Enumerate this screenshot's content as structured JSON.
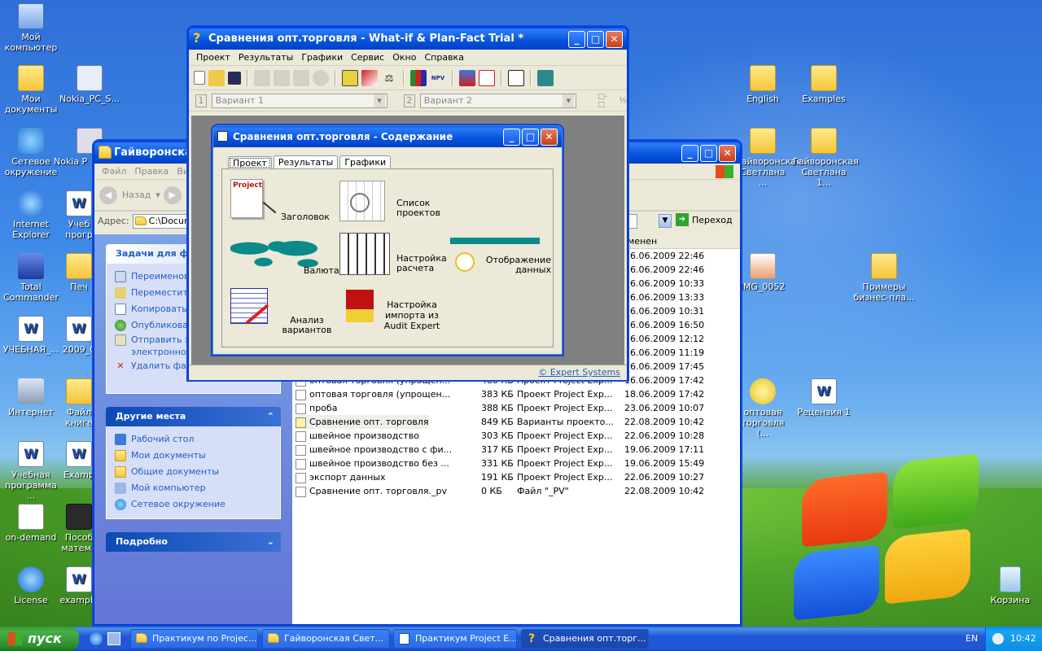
{
  "desktop": {
    "icons_left": [
      {
        "label": "Мой компьютер"
      },
      {
        "label": "Мои документы"
      },
      {
        "label": "Nokia_PC_S..."
      },
      {
        "label": "Сетевое окружение"
      },
      {
        "label": "Nokia P"
      },
      {
        "label": "Internet Explorer"
      },
      {
        "label": "Учеб прогр"
      },
      {
        "label": "Total Commander"
      },
      {
        "label": "Печ"
      },
      {
        "label": "УЧЕБНАЯ_..."
      },
      {
        "label": "2009_0"
      },
      {
        "label": "Интернет"
      },
      {
        "label": "Файл книге"
      },
      {
        "label": "Учебная программа ..."
      },
      {
        "label": "Examp"
      },
      {
        "label": "on-demand"
      },
      {
        "label": "Пособ матема"
      },
      {
        "label": "License"
      },
      {
        "label": "example"
      }
    ],
    "icons_right": [
      {
        "label": "English"
      },
      {
        "label": "Examples"
      },
      {
        "label": "Гайворонская Светлана ..."
      },
      {
        "label": "Гайворонская Светлана 1..."
      },
      {
        "label": "IMG_0052"
      },
      {
        "label": "Примеры бизнес-пла..."
      },
      {
        "label": "оптовая торговля (..."
      },
      {
        "label": "Рецензия 1"
      },
      {
        "label": "Корзина"
      }
    ]
  },
  "explorer": {
    "title": "Гайворонская",
    "menu": [
      "Файл",
      "Правка",
      "Ви"
    ],
    "back_label": "Назад",
    "address_label": "Адрес:",
    "address_value": "C:\\Docum",
    "go_label": "Переход",
    "col_modified": "менен",
    "tasks_title": "Задачи для фа",
    "tasks": [
      "Переименова",
      "Переместить",
      "Копировать",
      "Опубликоват",
      "Отправить э",
      "электронной",
      "Удалить фа"
    ],
    "other_title": "Другие места",
    "other": [
      "Рабочий стол",
      "Мои документы",
      "Общие документы",
      "Мой компьютер",
      "Сетевое окружение"
    ],
    "details_title": "Подробно",
    "files": [
      {
        "name": "",
        "size": "",
        "type": "",
        "date": "16.06.2009 22:46"
      },
      {
        "name": "",
        "size": "",
        "type": "",
        "date": "16.06.2009 22:46"
      },
      {
        "name": "",
        "size": "",
        "type": "",
        "date": "16.06.2009 10:33"
      },
      {
        "name": "",
        "size": "",
        "type": "",
        "date": "16.06.2009 13:33"
      },
      {
        "name": "",
        "size": "",
        "type": "",
        "date": "16.06.2009 10:31"
      },
      {
        "name": "",
        "size": "",
        "type": "",
        "date": "16.06.2009 16:50"
      },
      {
        "name": "",
        "size": "",
        "type": "",
        "date": "16.06.2009 12:12"
      },
      {
        "name": "",
        "size": "",
        "type": "",
        "date": "16.06.2009 11:19"
      },
      {
        "name": "",
        "size": "",
        "type": "",
        "date": "16.06.2009 17:45"
      },
      {
        "name": "оптовая торговля (упрощен...",
        "size": "480 КБ",
        "type": "Проект Project Exp...",
        "date": "16.06.2009 17:42"
      },
      {
        "name": "оптовая торговля (упрощен...",
        "size": "383 КБ",
        "type": "Проект Project Exp...",
        "date": "18.06.2009 17:42"
      },
      {
        "name": "проба",
        "size": "388 КБ",
        "type": "Проект Project Exp...",
        "date": "23.06.2009 10:07"
      },
      {
        "name": "Сравнение опт. торговля",
        "size": "849 КБ",
        "type": "Варианты проекто...",
        "date": "22.08.2009 10:42"
      },
      {
        "name": "швейное производство",
        "size": "303 КБ",
        "type": "Проект Project Exp...",
        "date": "22.06.2009 10:28"
      },
      {
        "name": "швейное производство с фи...",
        "size": "317 КБ",
        "type": "Проект Project Exp...",
        "date": "19.06.2009 17:11"
      },
      {
        "name": "швейное производство без ...",
        "size": "331 КБ",
        "type": "Проект Project Exp...",
        "date": "19.06.2009 15:49"
      },
      {
        "name": "экспорт данных",
        "size": "191 КБ",
        "type": "Проект Project Exp...",
        "date": "22.06.2009 10:27"
      },
      {
        "name": "Сравнение опт. торговля._pv",
        "size": "0 КБ",
        "type": "Файл \"_PV\"",
        "date": "22.08.2009 10:42"
      }
    ]
  },
  "whatif": {
    "title": "Сравнения опт.торговля - What-if & Plan-Fact Trial *",
    "menu": [
      "Проект",
      "Результаты",
      "Графики",
      "Сервис",
      "Окно",
      "Справка"
    ],
    "variant1_num": "1",
    "variant1": "Вариант 1",
    "variant2_num": "2",
    "variant2": "Вариант 2",
    "status_link": "© Expert Systems"
  },
  "contents": {
    "title": "Сравнения опт.торговля - Содержание",
    "tabs": [
      "Проект",
      "Результаты",
      "Графики"
    ],
    "items": [
      {
        "label": "Заголовок",
        "icon_text": "Project"
      },
      {
        "label": "Список проектов"
      },
      {
        "label": "Валюта"
      },
      {
        "label": "Настройка расчета"
      },
      {
        "label": "Отображение данных"
      },
      {
        "label": "Анализ вариантов"
      },
      {
        "label": "Настройка импорта из Audit Expert"
      }
    ]
  },
  "taskbar": {
    "start": "пуск",
    "tasks": [
      "Практикум по Projec...",
      "Гайворонская Свет...",
      "Практикум Project E...",
      "Сравнения опт.торг..."
    ],
    "lang": "EN",
    "clock": "10:42"
  },
  "colors": {
    "xp_blue": "#0a58e8",
    "task_link": "#215dc6",
    "accent_teal": "#0b8a8a"
  }
}
